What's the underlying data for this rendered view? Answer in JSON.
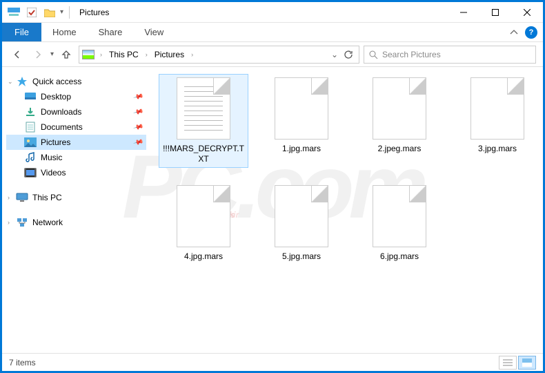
{
  "window": {
    "title": "Pictures"
  },
  "ribbon": {
    "file": "File",
    "tabs": [
      "Home",
      "Share",
      "View"
    ]
  },
  "breadcrumb": {
    "segments": [
      "This PC",
      "Pictures"
    ]
  },
  "search": {
    "placeholder": "Search Pictures"
  },
  "sidebar": {
    "quick_access": {
      "label": "Quick access",
      "items": [
        {
          "label": "Desktop",
          "pinned": true,
          "icon": "desktop"
        },
        {
          "label": "Downloads",
          "pinned": true,
          "icon": "downloads"
        },
        {
          "label": "Documents",
          "pinned": true,
          "icon": "documents"
        },
        {
          "label": "Pictures",
          "pinned": true,
          "icon": "pictures",
          "selected": true
        },
        {
          "label": "Music",
          "pinned": false,
          "icon": "music"
        },
        {
          "label": "Videos",
          "pinned": false,
          "icon": "videos"
        }
      ]
    },
    "this_pc": {
      "label": "This PC"
    },
    "network": {
      "label": "Network"
    }
  },
  "files": [
    {
      "name": "!!!MARS_DECRYPT.TXT",
      "type": "text",
      "selected": true
    },
    {
      "name": "1.jpg.mars",
      "type": "blank"
    },
    {
      "name": "2.jpeg.mars",
      "type": "blank"
    },
    {
      "name": "3.jpg.mars",
      "type": "blank"
    },
    {
      "name": "4.jpg.mars",
      "type": "blank"
    },
    {
      "name": "5.jpg.mars",
      "type": "blank"
    },
    {
      "name": "6.jpg.mars",
      "type": "blank"
    }
  ],
  "status": {
    "count_label": "7 items"
  }
}
